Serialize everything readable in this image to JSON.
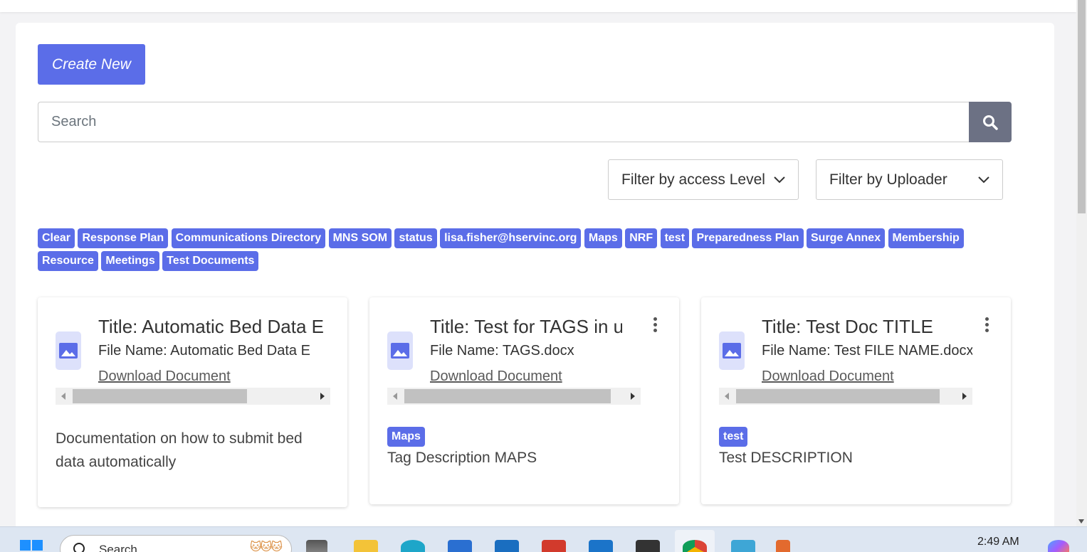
{
  "toolbar": {
    "create_label": "Create New"
  },
  "search": {
    "placeholder": "Search",
    "icon": "search-icon"
  },
  "filters": {
    "access_level": "Filter by access Level",
    "uploader": "Filter by Uploader"
  },
  "tags": [
    "Clear",
    "Response Plan",
    "Communications Directory",
    "MNS SOM",
    "status",
    "lisa.fisher@hservinc.org",
    "Maps",
    "NRF",
    "test",
    "Preparedness Plan",
    "Surge Annex",
    "Membership",
    "Resource",
    "Meetings",
    "Test Documents"
  ],
  "cards": [
    {
      "title": "Title: Automatic Bed Data E",
      "file_name": "File Name: Automatic Bed Data E",
      "download": "Download Document",
      "tag": "",
      "description": "Documentation on how to submit bed data automatically",
      "has_menu": false,
      "scroll_fraction": 0.68
    },
    {
      "title": "Title: Test for TAGS in us",
      "file_name": "File Name: TAGS.docx",
      "download": "Download Document",
      "tag": "Maps",
      "description": "Tag Description MAPS",
      "has_menu": true,
      "scroll_fraction": 0.82
    },
    {
      "title": "Title: Test Doc TITLE",
      "file_name": "File Name: Test FILE NAME.docx",
      "download": "Download Document",
      "tag": "test",
      "description": "Test DESCRIPTION",
      "has_menu": true,
      "scroll_fraction": 0.8
    }
  ],
  "taskbar": {
    "search_text": "Search",
    "time": "2:49 AM"
  },
  "colors": {
    "accent": "#5b6de8",
    "search_button": "#6c7184"
  }
}
